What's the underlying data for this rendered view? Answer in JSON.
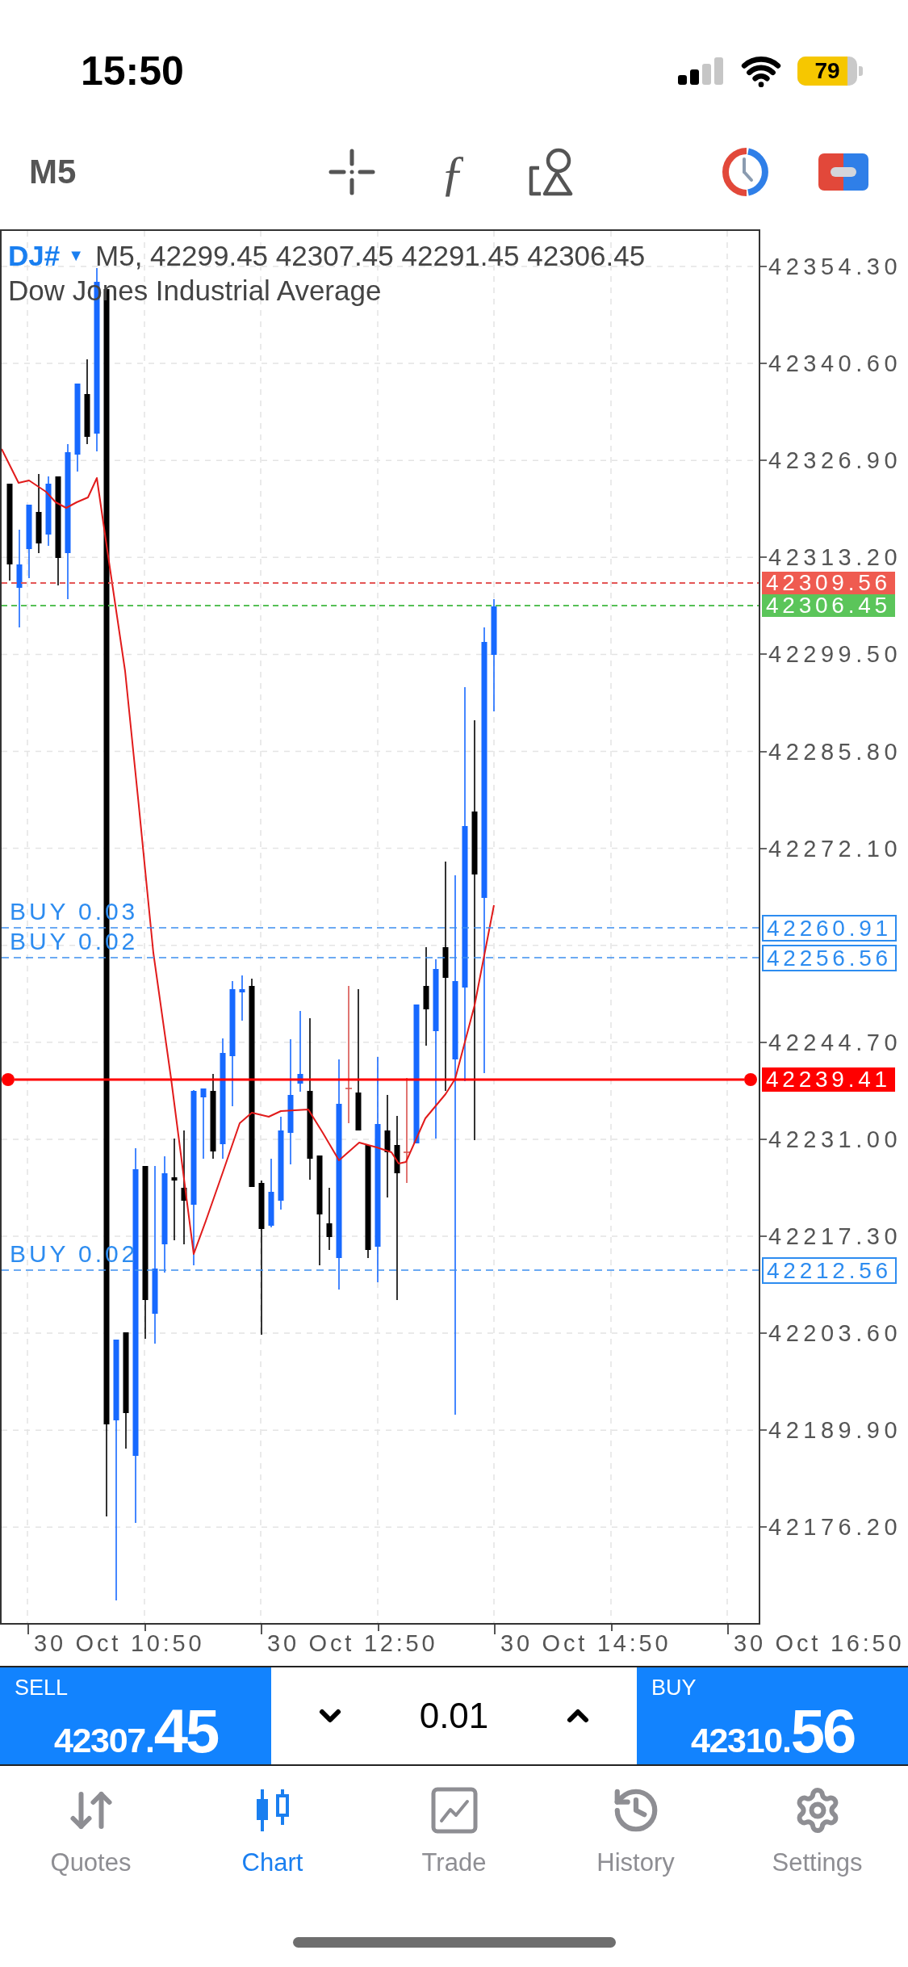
{
  "status_bar": {
    "time": "15:50",
    "battery": "79"
  },
  "toolbar": {
    "timeframe": "M5",
    "function_glyph": "ƒ"
  },
  "chart": {
    "symbol": "DJ#",
    "symbol_caret": "▼",
    "ohlc": "M5, 42299.45 42307.45 42291.45 42306.45",
    "description": "Dow Jones Industrial Average",
    "price_axis": [
      "42354.30",
      "42340.60",
      "42326.90",
      "42313.20",
      "42299.50",
      "42285.80",
      "42272.10",
      "42244.70",
      "42231.00",
      "42217.30",
      "42203.60",
      "42189.90",
      "42176.20"
    ],
    "ask_price": "42309.56",
    "bid_price": "42306.45",
    "orders": [
      {
        "label": "BUY 0.03",
        "price": "42260.91"
      },
      {
        "label": "BUY 0.02",
        "price": "42256.56"
      },
      {
        "label": "BUY 0.02",
        "price": "42212.56"
      }
    ],
    "horizontal_line": {
      "price": "42239.41"
    },
    "time_axis": [
      "30 Oct 10:50",
      "30 Oct 12:50",
      "30 Oct 14:50",
      "30 Oct 16:50"
    ]
  },
  "trade_panel": {
    "sell": {
      "label": "SELL",
      "price": "42307.",
      "price_large": "45"
    },
    "volume": "0.01",
    "buy": {
      "label": "BUY",
      "price": "42310.",
      "price_large": "56"
    }
  },
  "tabs": [
    {
      "label": "Quotes",
      "selected": false
    },
    {
      "label": "Chart",
      "selected": true
    },
    {
      "label": "Trade",
      "selected": false
    },
    {
      "label": "History",
      "selected": false
    },
    {
      "label": "Settings",
      "selected": false
    }
  ]
}
